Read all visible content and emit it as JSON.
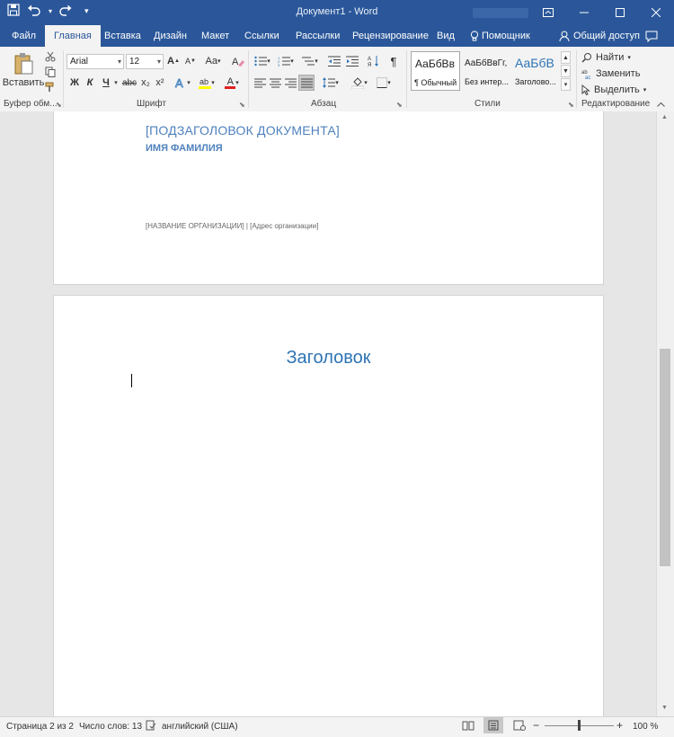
{
  "window": {
    "title": "Документ1 - Word"
  },
  "tabs": [
    {
      "label": "Файл"
    },
    {
      "label": "Главная",
      "active": true
    },
    {
      "label": "Вставка"
    },
    {
      "label": "Дизайн"
    },
    {
      "label": "Макет"
    },
    {
      "label": "Ссылки"
    },
    {
      "label": "Рассылки"
    },
    {
      "label": "Рецензирование"
    },
    {
      "label": "Вид"
    }
  ],
  "tell_me": "Помощник",
  "share": "Общий доступ",
  "ribbon": {
    "clipboard": {
      "paste_label": "Вставить",
      "group_label": "Буфер обм..."
    },
    "font": {
      "font_name": "Arial",
      "font_size": "12",
      "case_label": "Аа",
      "bold": "Ж",
      "italic": "К",
      "underline": "Ч",
      "strike": "abc",
      "subscript": "x₂",
      "superscript": "x²",
      "font_color": "А",
      "group_label": "Шрифт"
    },
    "paragraph": {
      "pilcrow": "¶",
      "group_label": "Абзац"
    },
    "styles": {
      "items": [
        {
          "preview": "АаБбВв",
          "name": "¶ Обычный"
        },
        {
          "preview": "АаБбВвГг,",
          "name": "Без интер..."
        },
        {
          "preview": "АаБбВ",
          "name": "Заголово..."
        }
      ],
      "group_label": "Стили"
    },
    "editing": {
      "find": "Найти",
      "replace": "Заменить",
      "select": "Выделить",
      "group_label": "Редактирование"
    }
  },
  "document": {
    "page1": {
      "subtitle": "[ПОДЗАГОЛОВОК ДОКУМЕНТА]",
      "author": "ИМЯ ФАМИЛИЯ",
      "org_line": "[НАЗВАНИЕ ОРГАНИЗАЦИИ] | [Адрес организации]"
    },
    "page2": {
      "heading": "Заголовок"
    }
  },
  "status": {
    "page": "Страница 2 из 2",
    "words": "Число слов: 13",
    "language": "английский (США)",
    "zoom": "100 %"
  },
  "colors": {
    "accent": "#2b579a",
    "doc_blue": "#4f81bd",
    "heading_blue": "#2e74b5"
  }
}
